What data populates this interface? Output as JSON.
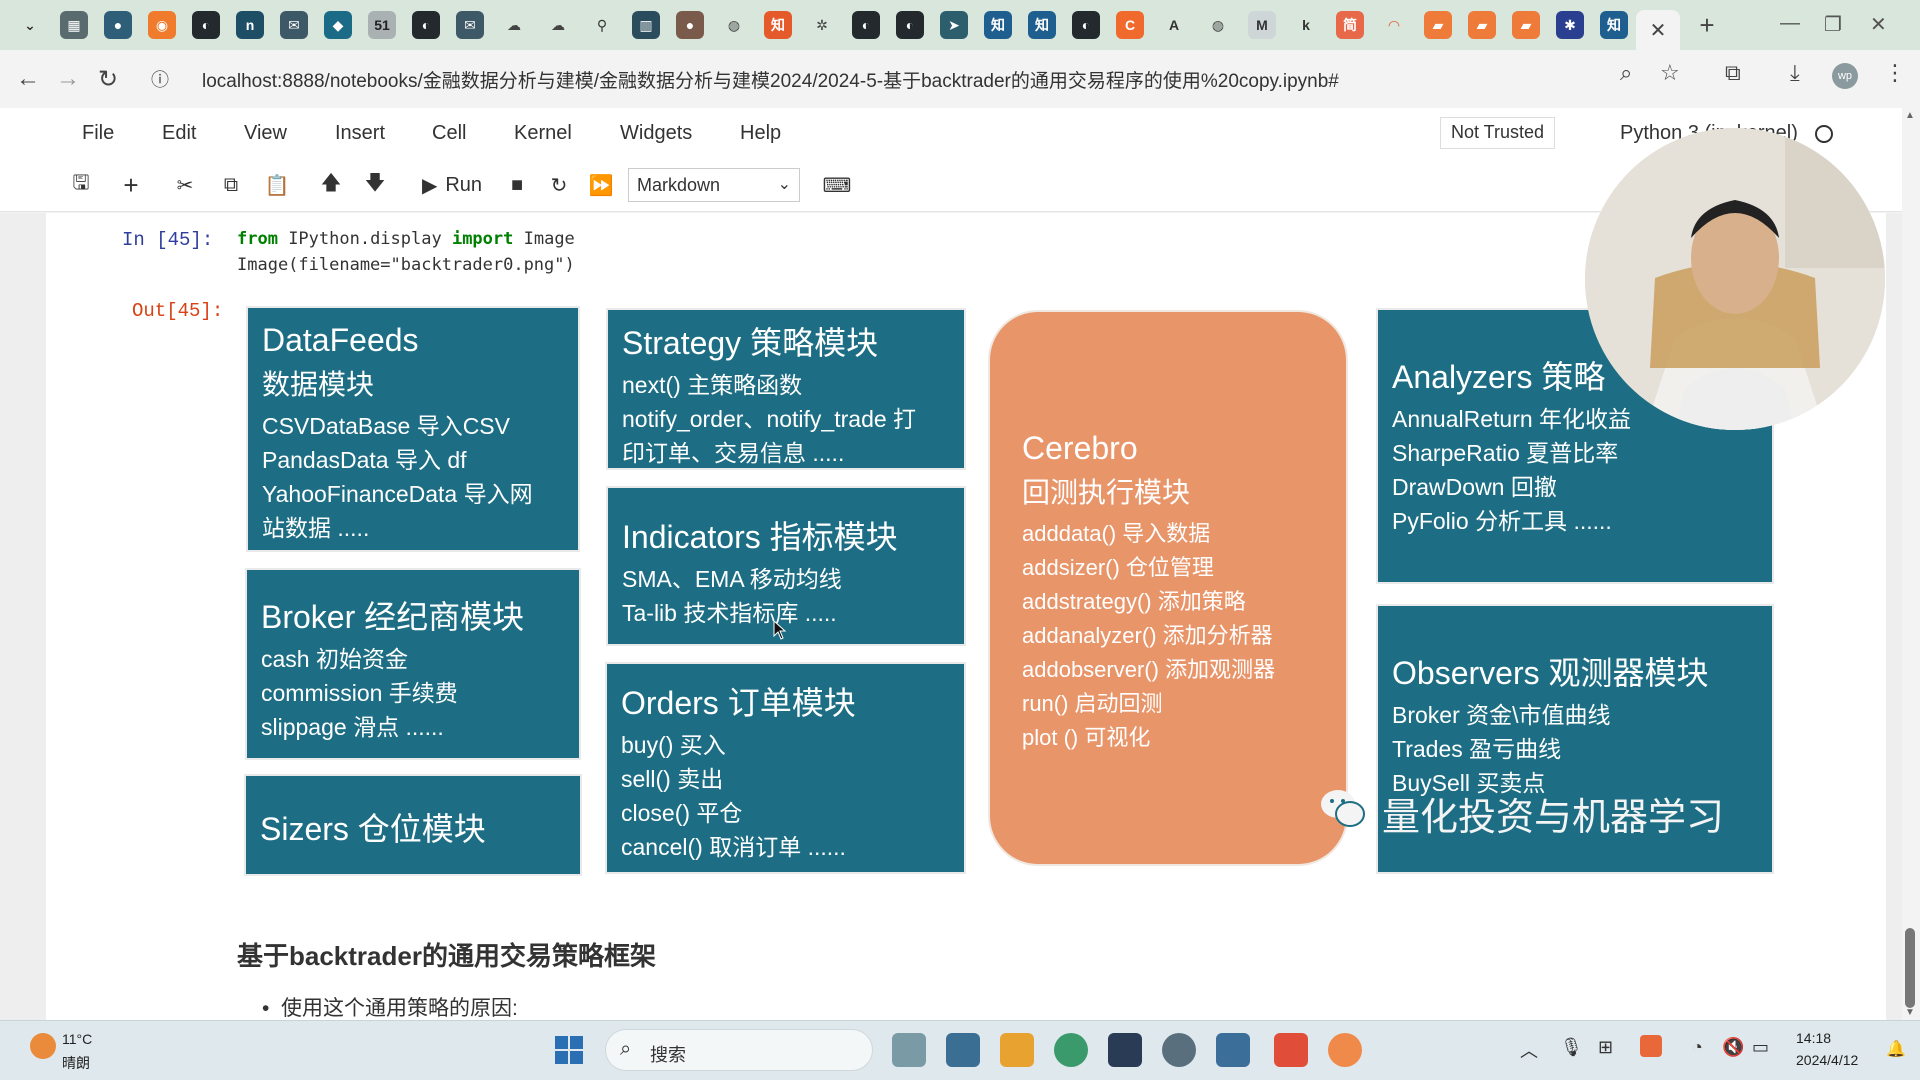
{
  "browser": {
    "url": "localhost:8888/notebooks/金融数据分析与建模/金融数据分析与建模2024/2024-5-基于backtrader的通用交易程序的使用%20copy.ipynb#",
    "profile_badge": "wp",
    "tab_icons": [
      {
        "name": "tab-collapse-icon",
        "color": "#d8e6dc",
        "glyph": "⌄",
        "fg": "#333"
      },
      {
        "name": "calendar-icon",
        "color": "#5a6b70",
        "glyph": "▦",
        "fg": "#fff"
      },
      {
        "name": "chat-icon",
        "color": "#2f5f78",
        "glyph": "●",
        "fg": "#fff"
      },
      {
        "name": "orange-app-icon",
        "color": "#f07b2c",
        "glyph": "◉",
        "fg": "#fff"
      },
      {
        "name": "github-icon",
        "color": "#24292e",
        "glyph": "◐",
        "fg": "#fff"
      },
      {
        "name": "notion-icon",
        "color": "#1e4d66",
        "glyph": "n",
        "fg": "#fff"
      },
      {
        "name": "mail-icon",
        "color": "#3d5866",
        "glyph": "✉",
        "fg": "#fff"
      },
      {
        "name": "bookmark-icon",
        "color": "#1c6b86",
        "glyph": "◆",
        "fg": "#fff"
      },
      {
        "name": "calendar-51-icon",
        "color": "#a9b1b3",
        "glyph": "51",
        "fg": "#222"
      },
      {
        "name": "github-icon",
        "color": "#24292e",
        "glyph": "◐",
        "fg": "#fff"
      },
      {
        "name": "mail-icon",
        "color": "#3d5866",
        "glyph": "✉",
        "fg": "#fff"
      },
      {
        "name": "cloud-icon",
        "color": "#d8e6dc",
        "glyph": "☁",
        "fg": "#444"
      },
      {
        "name": "cloud-icon",
        "color": "#d8e6dc",
        "glyph": "☁",
        "fg": "#444"
      },
      {
        "name": "figure-icon",
        "color": "#d8e6dc",
        "glyph": "⚲",
        "fg": "#333"
      },
      {
        "name": "book-icon",
        "color": "#2a4c5c",
        "glyph": "▥",
        "fg": "#fff"
      },
      {
        "name": "avatar-icon",
        "color": "#7a5a4a",
        "glyph": "●",
        "fg": "#fff"
      },
      {
        "name": "globe-icon",
        "color": "#d8e6dc",
        "glyph": "◍",
        "fg": "#444"
      },
      {
        "name": "zhihu-icon",
        "color": "#e55a2b",
        "glyph": "知",
        "fg": "#fff"
      },
      {
        "name": "gear-icon",
        "color": "#d8e6dc",
        "glyph": "✲",
        "fg": "#444"
      },
      {
        "name": "github-icon",
        "color": "#24292e",
        "glyph": "◐",
        "fg": "#fff"
      },
      {
        "name": "github-icon",
        "color": "#24292e",
        "glyph": "◐",
        "fg": "#fff"
      },
      {
        "name": "rocket-icon",
        "color": "#2d5e6e",
        "glyph": "➤",
        "fg": "#fff"
      },
      {
        "name": "zhihu-icon",
        "color": "#1f5f8f",
        "glyph": "知",
        "fg": "#fff"
      },
      {
        "name": "zhihu-icon",
        "color": "#1f5f8f",
        "glyph": "知",
        "fg": "#fff"
      },
      {
        "name": "github-icon",
        "color": "#24292e",
        "glyph": "◐",
        "fg": "#fff"
      },
      {
        "name": "c-app-icon",
        "color": "#ef6a2c",
        "glyph": "C",
        "fg": "#fff"
      },
      {
        "name": "font-icon",
        "color": "#d8e6dc",
        "glyph": "A",
        "fg": "#333"
      },
      {
        "name": "globe-icon",
        "color": "#d8e6dc",
        "glyph": "◍",
        "fg": "#444"
      },
      {
        "name": "m-app-icon",
        "color": "#cfd6d8",
        "glyph": "M",
        "fg": "#333"
      },
      {
        "name": "k-app-icon",
        "color": "#d8e6dc",
        "glyph": "k",
        "fg": "#333"
      },
      {
        "name": "jian-icon",
        "color": "#e8684a",
        "glyph": "简",
        "fg": "#fff"
      },
      {
        "name": "arc-icon",
        "color": "#d8e6dc",
        "glyph": "◠",
        "fg": "#e05a2a"
      },
      {
        "name": "book-orange-icon",
        "color": "#ee7b3a",
        "glyph": "▰",
        "fg": "#fff"
      },
      {
        "name": "book-orange-icon",
        "color": "#ee7b3a",
        "glyph": "▰",
        "fg": "#fff"
      },
      {
        "name": "book-orange-icon",
        "color": "#ee7b3a",
        "glyph": "▰",
        "fg": "#fff"
      },
      {
        "name": "paw-icon",
        "color": "#2a3f8f",
        "glyph": "✱",
        "fg": "#fff"
      },
      {
        "name": "zhihu-icon",
        "color": "#1f5f8f",
        "glyph": "知",
        "fg": "#fff"
      }
    ]
  },
  "jupyter": {
    "menu": [
      "File",
      "Edit",
      "View",
      "Insert",
      "Cell",
      "Kernel",
      "Widgets",
      "Help"
    ],
    "trust_status": "Not Trusted",
    "kernel": "Python 3 (ipykernel)",
    "toolbar": {
      "run_label": "Run",
      "cell_type": "Markdown"
    }
  },
  "cell": {
    "in_prompt": "In  [45]:",
    "out_prompt": "Out[45]:",
    "code_line1_kw1": "from",
    "code_line1_mod": " IPython.display ",
    "code_line1_kw2": "import",
    "code_line1_name": " Image",
    "code_line2": "Image(filename=\"backtrader0.png\")"
  },
  "diagram": {
    "datafeeds": {
      "title": "DataFeeds",
      "subtitle": "数据模块",
      "lines": [
        "CSVDataBase 导入CSV",
        "PandasData 导入 df",
        "YahooFinanceData 导入网",
        "站数据 ....."
      ]
    },
    "broker": {
      "title": "Broker  经纪商模块",
      "lines": [
        "cash 初始资金",
        "commission 手续费",
        "slippage 滑点 ......"
      ]
    },
    "sizers": {
      "title": "Sizers  仓位模块"
    },
    "strategy": {
      "title": "Strategy  策略模块",
      "lines": [
        "next() 主策略函数",
        "notify_order、notify_trade 打",
        "印订单、交易信息 ....."
      ]
    },
    "indicators": {
      "title": "Indicators  指标模块",
      "lines": [
        "SMA、EMA 移动均线",
        "Ta-lib 技术指标库 ....."
      ]
    },
    "orders": {
      "title": "Orders  订单模块",
      "lines": [
        "buy() 买入",
        "sell() 卖出",
        "close() 平仓",
        "cancel() 取消订单 ......"
      ]
    },
    "cerebro": {
      "title": "Cerebro",
      "subtitle": "回测执行模块",
      "lines": [
        "adddata() 导入数据",
        "addsizer() 仓位管理",
        "addstrategy() 添加策略",
        "addanalyzer() 添加分析器",
        "addobserver() 添加观测器",
        "run() 启动回测",
        "plot () 可视化"
      ]
    },
    "analyzers": {
      "title": "Analyzers  策略",
      "lines": [
        "AnnualReturn 年化收益",
        "SharpeRatio 夏普比率",
        "DrawDown 回撤",
        "PyFolio 分析工具 ......"
      ]
    },
    "observers": {
      "title": "Observers  观测器模块",
      "lines": [
        "Broker 资金\\市值曲线",
        "Trades 盈亏曲线",
        "BuySell 买卖点"
      ]
    },
    "watermark": "量化投资与机器学习",
    "colors": {
      "box": "#1d6e84",
      "cerebro": "#e8956a"
    }
  },
  "markdown": {
    "heading": "基于backtrader的通用交易策略框架",
    "bullet": "使用这个通用策略的原因:"
  },
  "taskbar": {
    "weather_temp": "11°C",
    "weather_desc": "晴朗",
    "search_label": "搜索",
    "time": "14:18",
    "date": "2024/4/12"
  }
}
